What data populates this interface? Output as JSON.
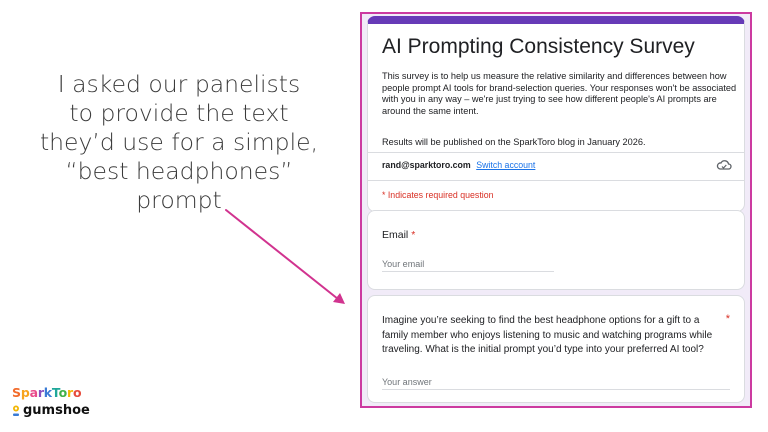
{
  "slide": {
    "caption_lines": [
      "I asked our panelists",
      "to provide the text",
      "they’d use for a simple,",
      "“best headphones”",
      "prompt"
    ],
    "arrow_color": "#d1338f"
  },
  "logos": {
    "sparktoro": {
      "letters": [
        "S",
        "p",
        "a",
        "r",
        "k",
        "T",
        "o",
        "r",
        "o"
      ],
      "colors": [
        "#f26b2b",
        "#f7a41d",
        "#e94b8b",
        "#8a4fbf",
        "#3a7bd5",
        "#1fa79a",
        "#41b14a",
        "#f2b705",
        "#e64a3b"
      ]
    },
    "gumshoe": {
      "text": "gumshoe",
      "icon": "location-pin-icon"
    }
  },
  "form": {
    "accent_color": "#673ab7",
    "frame_color": "#cc3aa0",
    "title": "AI Prompting Consistency Survey",
    "description": "This survey is to help us measure the relative similarity and differences between how people prompt AI tools for brand-selection queries. Your responses won't be associated with you in any way – we're just trying to see how different people's AI prompts are around the same intent.",
    "note": "Results will be published on the SparkToro blog in January 2026.",
    "account_email": "rand@sparktoro.com",
    "switch_account_label": "Switch account",
    "cloud_icon": "cloud-saved-icon",
    "required_note": "* Indicates required question",
    "questions": [
      {
        "label": "Email",
        "required_mark": "*",
        "placeholder": "Your email"
      },
      {
        "label": "Imagine you’re seeking to find the best headphone options for a gift to a family member who enjoys listening to music and watching programs while traveling. What is the initial prompt you’d type into your preferred AI tool?",
        "required_mark": "*",
        "placeholder": "Your answer"
      }
    ]
  }
}
